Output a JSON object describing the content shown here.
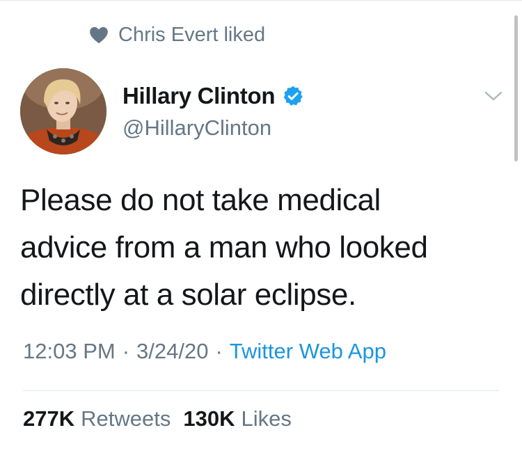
{
  "social_context": {
    "icon": "heart-icon",
    "text": "Chris Evert liked"
  },
  "author": {
    "display_name": "Hillary Clinton",
    "handle": "@HillaryClinton",
    "verified": true,
    "verified_color": "#1da1f2"
  },
  "tweet": {
    "lines": [
      "Please do not take medical",
      "advice from a man who looked",
      "directly at a solar eclipse."
    ],
    "time": "12:03 PM",
    "date": "3/24/20",
    "source": "Twitter Web App"
  },
  "stats": {
    "retweets_count": "277K",
    "retweets_label": "Retweets",
    "likes_count": "130K",
    "likes_label": "Likes"
  },
  "colors": {
    "text_primary": "#14171a",
    "text_secondary": "#657786",
    "link": "#1b95e0",
    "divider": "#e1e8ed"
  }
}
